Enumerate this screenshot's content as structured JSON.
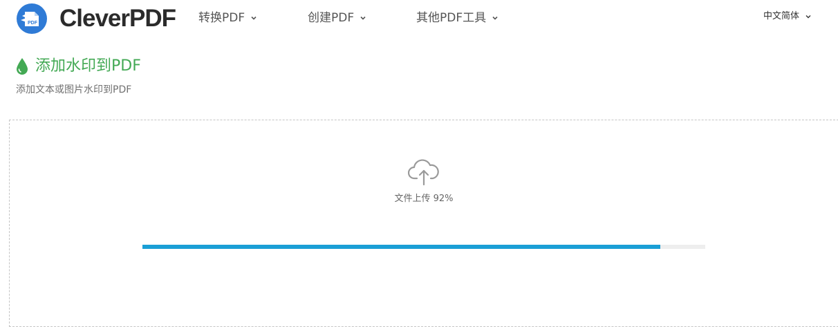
{
  "header": {
    "logo_text": "CleverPDF",
    "logo_badge": "PDF",
    "nav": [
      {
        "label": "转换PDF"
      },
      {
        "label": "创建PDF"
      },
      {
        "label": "其他PDF工具"
      }
    ],
    "language": "中文简体"
  },
  "page": {
    "title": "添加水印到PDF",
    "subtitle": "添加文本或图片水印到PDF"
  },
  "upload": {
    "status_text": "文件上传 92%",
    "progress_percent": 92
  },
  "colors": {
    "accent_green": "#43a954",
    "logo_blue": "#2f7bd6",
    "progress_blue": "#1a9fd6"
  },
  "icons": {
    "logo": "cleverpdf-logo-icon",
    "title": "water-drop-icon",
    "upload": "cloud-upload-icon",
    "dropdown": "chevron-down-icon"
  }
}
